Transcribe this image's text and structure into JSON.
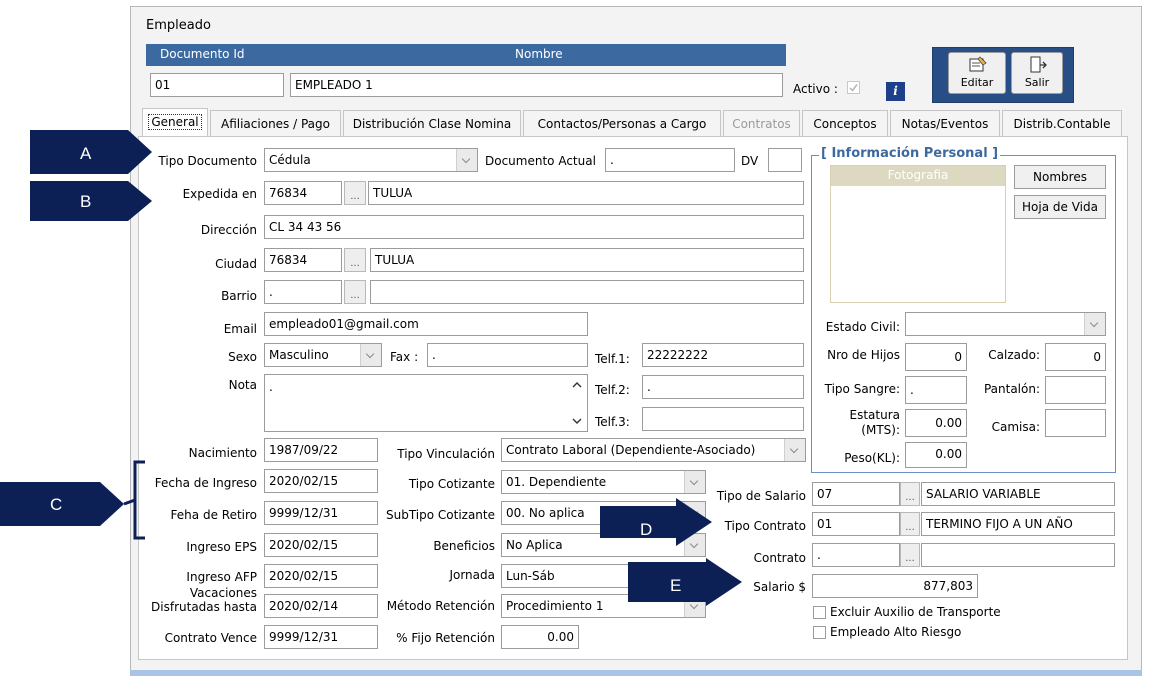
{
  "window": {
    "title": "Empleado"
  },
  "header": {
    "doc_id_label": "Documento Id",
    "name_label": "Nombre",
    "doc_id_value": "01",
    "name_value": "EMPLEADO 1",
    "activo_label": "Activo :",
    "info_icon_text": "i",
    "edit_label": "Editar",
    "exit_label": "Salir"
  },
  "tabs": [
    {
      "label": "General",
      "active": true
    },
    {
      "label": "Afiliaciones / Pago"
    },
    {
      "label": "Distribución Clase Nomina"
    },
    {
      "label": "Contactos/Personas a Cargo"
    },
    {
      "label": "Contratos",
      "disabled": true
    },
    {
      "label": "Conceptos"
    },
    {
      "label": "Notas/Eventos"
    },
    {
      "label": "Distrib.Contable"
    }
  ],
  "general": {
    "tipo_documento_label": "Tipo Documento",
    "tipo_documento_value": "Cédula",
    "documento_actual_label": "Documento Actual",
    "documento_actual_value": ".",
    "dv_label": "DV",
    "dv_value": "",
    "expedida_label": "Expedida en",
    "expedida_code": "76834",
    "expedida_city": "TULUA",
    "direccion_label": "Dirección",
    "direccion_value": "CL 34 43 56",
    "ciudad_label": "Ciudad",
    "ciudad_code": "76834",
    "ciudad_name": "TULUA",
    "barrio_label": "Barrio",
    "barrio_code": ".",
    "barrio_name": "",
    "email_label": "Email",
    "email_value": "empleado01@gmail.com",
    "sexo_label": "Sexo",
    "sexo_value": "Masculino",
    "fax_label": "Fax :",
    "fax_value": ".",
    "telf1_label": "Telf.1:",
    "telf1_value": "22222222",
    "telf2_label": "Telf.2:",
    "telf2_value": ".",
    "telf3_label": "Telf.3:",
    "telf3_value": "",
    "nota_label": "Nota",
    "nota_value": ".",
    "nacimiento_label": "Nacimiento",
    "nacimiento_value": "1987/09/22",
    "fecha_ingreso_label": "Fecha de Ingreso",
    "fecha_ingreso_value": "2020/02/15",
    "fecha_retiro_label": "Feha de Retiro",
    "fecha_retiro_value": "9999/12/31",
    "ingreso_eps_label": "Ingreso EPS",
    "ingreso_eps_value": "2020/02/15",
    "ingreso_afp_label": "Ingreso AFP",
    "ingreso_afp_value": "2020/02/15",
    "vacaciones_label_1": "Vacaciones",
    "vacaciones_label_2": "Disfrutadas hasta",
    "vacaciones_value": "2020/02/14",
    "contrato_vence_label": "Contrato Vence",
    "contrato_vence_value": "9999/12/31",
    "tipo_vinculacion_label": "Tipo Vinculación",
    "tipo_vinculacion_value": "Contrato Laboral (Dependiente-Asociado)",
    "tipo_cotizante_label": "Tipo Cotizante",
    "tipo_cotizante_value": "01. Dependiente",
    "subtipo_cotizante_label": "SubTipo Cotizante",
    "subtipo_cotizante_value": "00. No aplica",
    "beneficios_label": "Beneficios",
    "beneficios_value": "No Aplica",
    "jornada_label": "Jornada",
    "jornada_value": "Lun-Sáb",
    "metodo_retencion_label": "Método Retención",
    "metodo_retencion_value": "Procedimiento 1",
    "fijo_retencion_label": "% Fijo Retención",
    "fijo_retencion_value": "0.00",
    "tipo_salario_label": "Tipo de Salario",
    "tipo_salario_code": "07",
    "tipo_salario_name": "SALARIO VARIABLE",
    "tipo_contrato_label": "Tipo Contrato",
    "tipo_contrato_code": "01",
    "tipo_contrato_name": "TERMINO FIJO A UN AÑO",
    "contrato_label": "Contrato",
    "contrato_code": ".",
    "contrato_name": "",
    "salario_label": "Salario $",
    "salario_value": "877,803",
    "excluir_auxilio_label": "Excluir Auxilio de Transporte",
    "alto_riesgo_label": "Empleado Alto Riesgo"
  },
  "info_personal": {
    "title": "[ Información Personal ]",
    "foto_label": "Fotografia",
    "nombres_button": "Nombres",
    "hoja_vida_button": "Hoja de Vida",
    "estado_civil_label": "Estado Civil:",
    "estado_civil_value": "",
    "nro_hijos_label": "Nro de Hijos",
    "nro_hijos_value": "0",
    "calzado_label": "Calzado:",
    "calzado_value": "0",
    "tipo_sangre_label": "Tipo Sangre:",
    "tipo_sangre_value": ".",
    "pantalon_label": "Pantalón:",
    "pantalon_value": "",
    "estatura_label_1": "Estatura",
    "estatura_label_2": "(MTS):",
    "estatura_value": "0.00",
    "camisa_label": "Camisa:",
    "camisa_value": "",
    "peso_label": "Peso(KL):",
    "peso_value": "0.00"
  },
  "callouts": {
    "a": "A",
    "b": "B",
    "c": "C",
    "d": "D",
    "e": "E"
  },
  "colors": {
    "header_bar": "#3c6aa0",
    "callout": "#0c2056",
    "info_border": "#6f8fc0",
    "info_title": "#3c6aa0"
  }
}
